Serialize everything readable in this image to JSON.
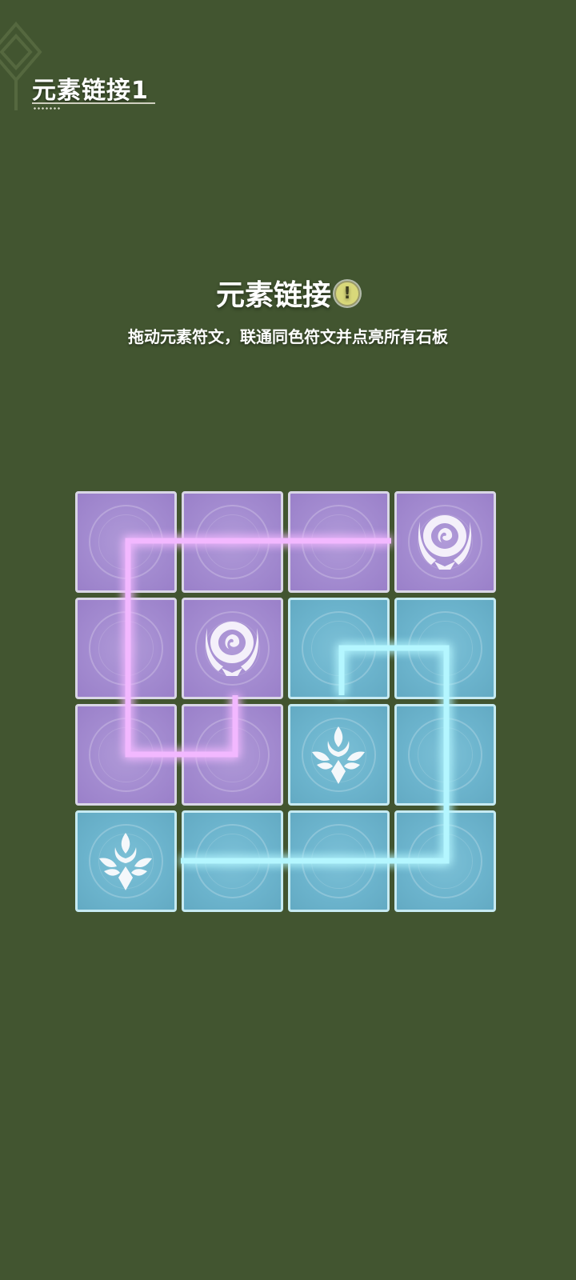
{
  "level": {
    "title": "元素链接1"
  },
  "puzzle": {
    "title": "元素链接",
    "instruction": "拖动元素符文，联通同色符文并点亮所有石板"
  },
  "colors": {
    "background": "#425530",
    "purple_tile": "#a38bd0",
    "blue_tile": "#6cb4cd",
    "purple_link": "#f0b0ff",
    "blue_link": "#aef4ff"
  },
  "board": {
    "rows": [
      [
        {
          "color": "purple",
          "symbol": null
        },
        {
          "color": "purple",
          "symbol": null
        },
        {
          "color": "purple",
          "symbol": null
        },
        {
          "color": "purple",
          "symbol": "electro-emblem"
        }
      ],
      [
        {
          "color": "purple",
          "symbol": null
        },
        {
          "color": "purple",
          "symbol": "electro-emblem"
        },
        {
          "color": "blue",
          "symbol": null
        },
        {
          "color": "blue",
          "symbol": null
        }
      ],
      [
        {
          "color": "purple",
          "symbol": null
        },
        {
          "color": "purple",
          "symbol": null
        },
        {
          "color": "blue",
          "symbol": "cryo-emblem"
        },
        {
          "color": "blue",
          "symbol": null
        }
      ],
      [
        {
          "color": "blue",
          "symbol": "cryo-emblem"
        },
        {
          "color": "blue",
          "symbol": null
        },
        {
          "color": "blue",
          "symbol": null
        },
        {
          "color": "blue",
          "symbol": null
        }
      ]
    ]
  }
}
